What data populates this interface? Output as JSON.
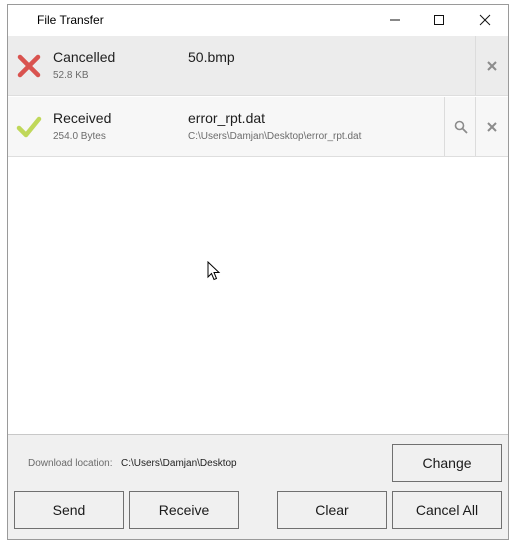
{
  "window": {
    "title": "File Transfer"
  },
  "titlebar_icons": {
    "minimize": "minimize-icon",
    "maximize": "maximize-icon",
    "close": "close-icon"
  },
  "transfers": [
    {
      "status": "Cancelled",
      "status_icon": "cross-icon",
      "status_color": "#d9534f",
      "size": "52.8 KB",
      "file_name": "50.bmp",
      "path": "",
      "actions": [
        "remove-icon"
      ]
    },
    {
      "status": "Received",
      "status_icon": "check-icon",
      "status_color": "#c0d85a",
      "size": "254.0 Bytes",
      "file_name": "error_rpt.dat",
      "path": "C:\\Users\\Damjan\\Desktop\\error_rpt.dat",
      "actions": [
        "search-icon",
        "remove-icon"
      ]
    }
  ],
  "download": {
    "label": "Download location:",
    "path": "C:\\Users\\Damjan\\Desktop",
    "change_label": "Change"
  },
  "buttons": {
    "send": "Send",
    "receive": "Receive",
    "clear": "Clear",
    "cancel_all": "Cancel All"
  }
}
